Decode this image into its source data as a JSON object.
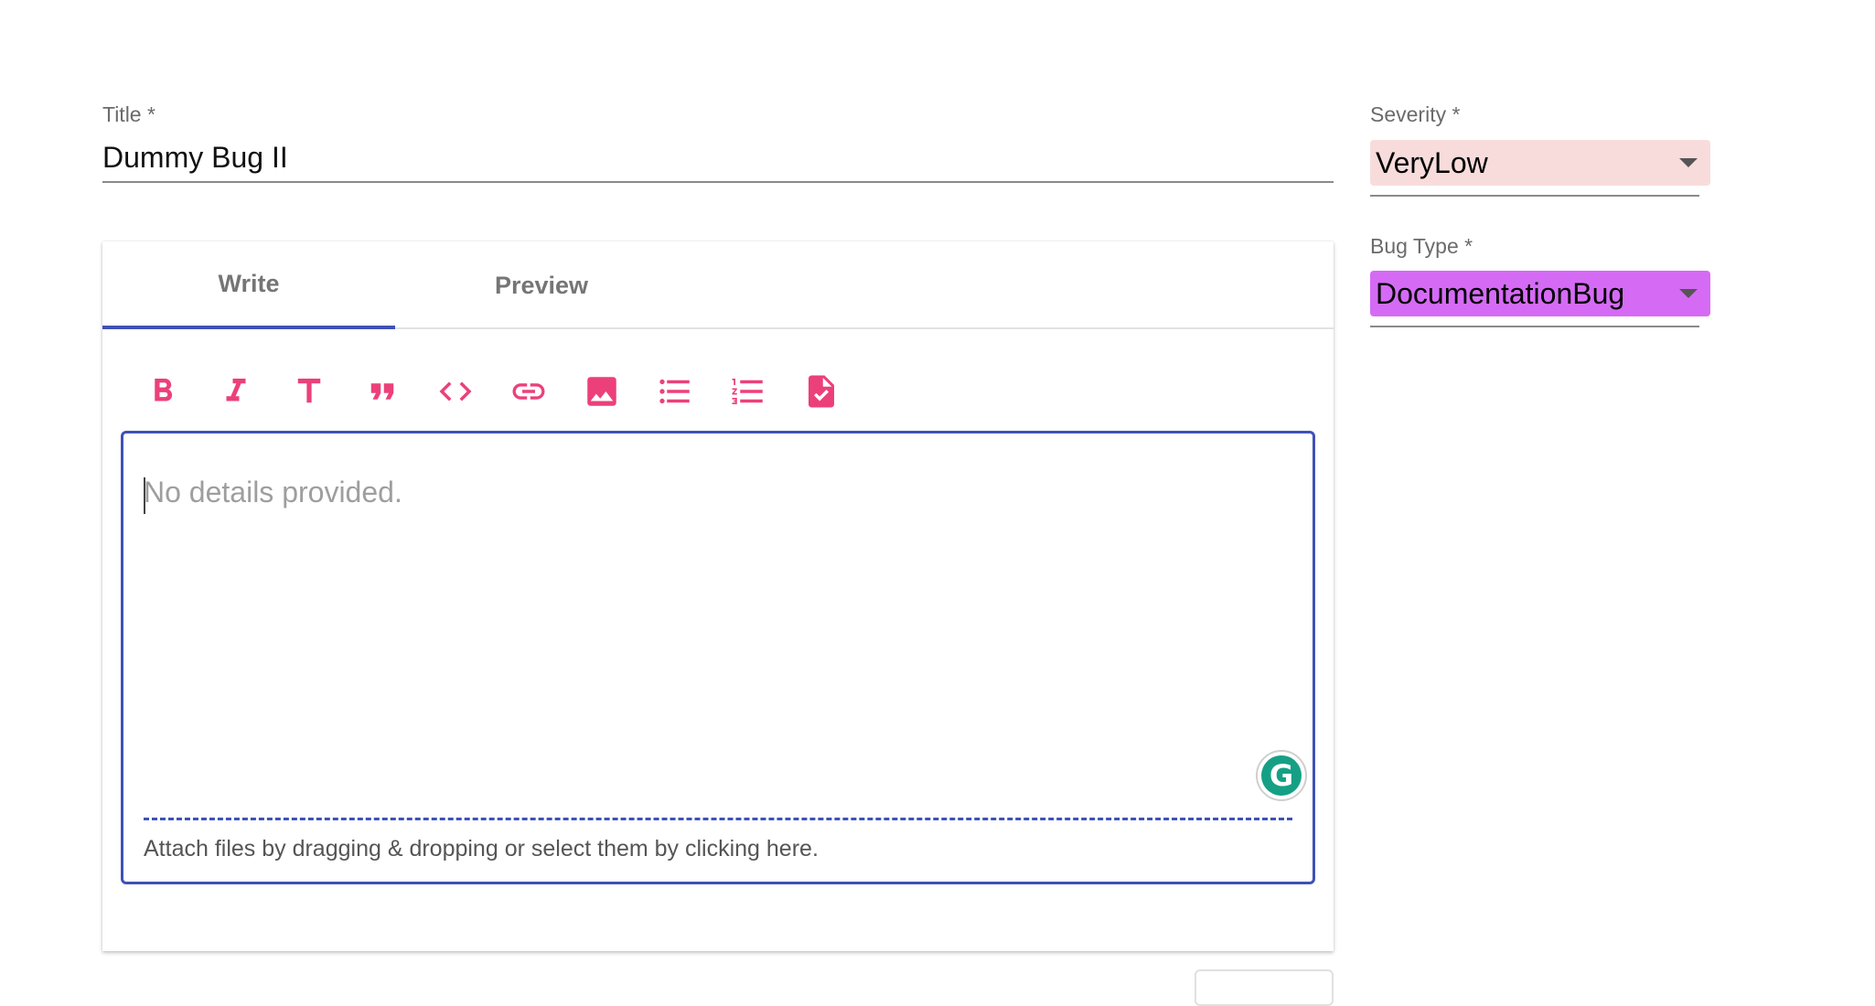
{
  "title_field": {
    "label": "Title *",
    "value": "Dummy Bug II"
  },
  "editor": {
    "tabs": [
      {
        "label": "Write"
      },
      {
        "label": "Preview"
      }
    ],
    "toolbar_icons": [
      "bold-icon",
      "italic-icon",
      "header-icon",
      "quote-icon",
      "code-icon",
      "link-icon",
      "image-icon",
      "unordered-list-icon",
      "ordered-list-icon",
      "checked-list-icon"
    ],
    "placeholder": "No details provided.",
    "attach_text": "Attach files by dragging & dropping or select them by clicking here.",
    "grammarly_letter": "G"
  },
  "severity": {
    "label": "Severity *",
    "value": "VeryLow",
    "color": "#f8dcdc"
  },
  "bug_type": {
    "label": "Bug Type *",
    "value": "DocumentationBug",
    "color": "#d56bf5"
  },
  "colors": {
    "accent": "#3f51b5",
    "icon": "#ec407a"
  }
}
